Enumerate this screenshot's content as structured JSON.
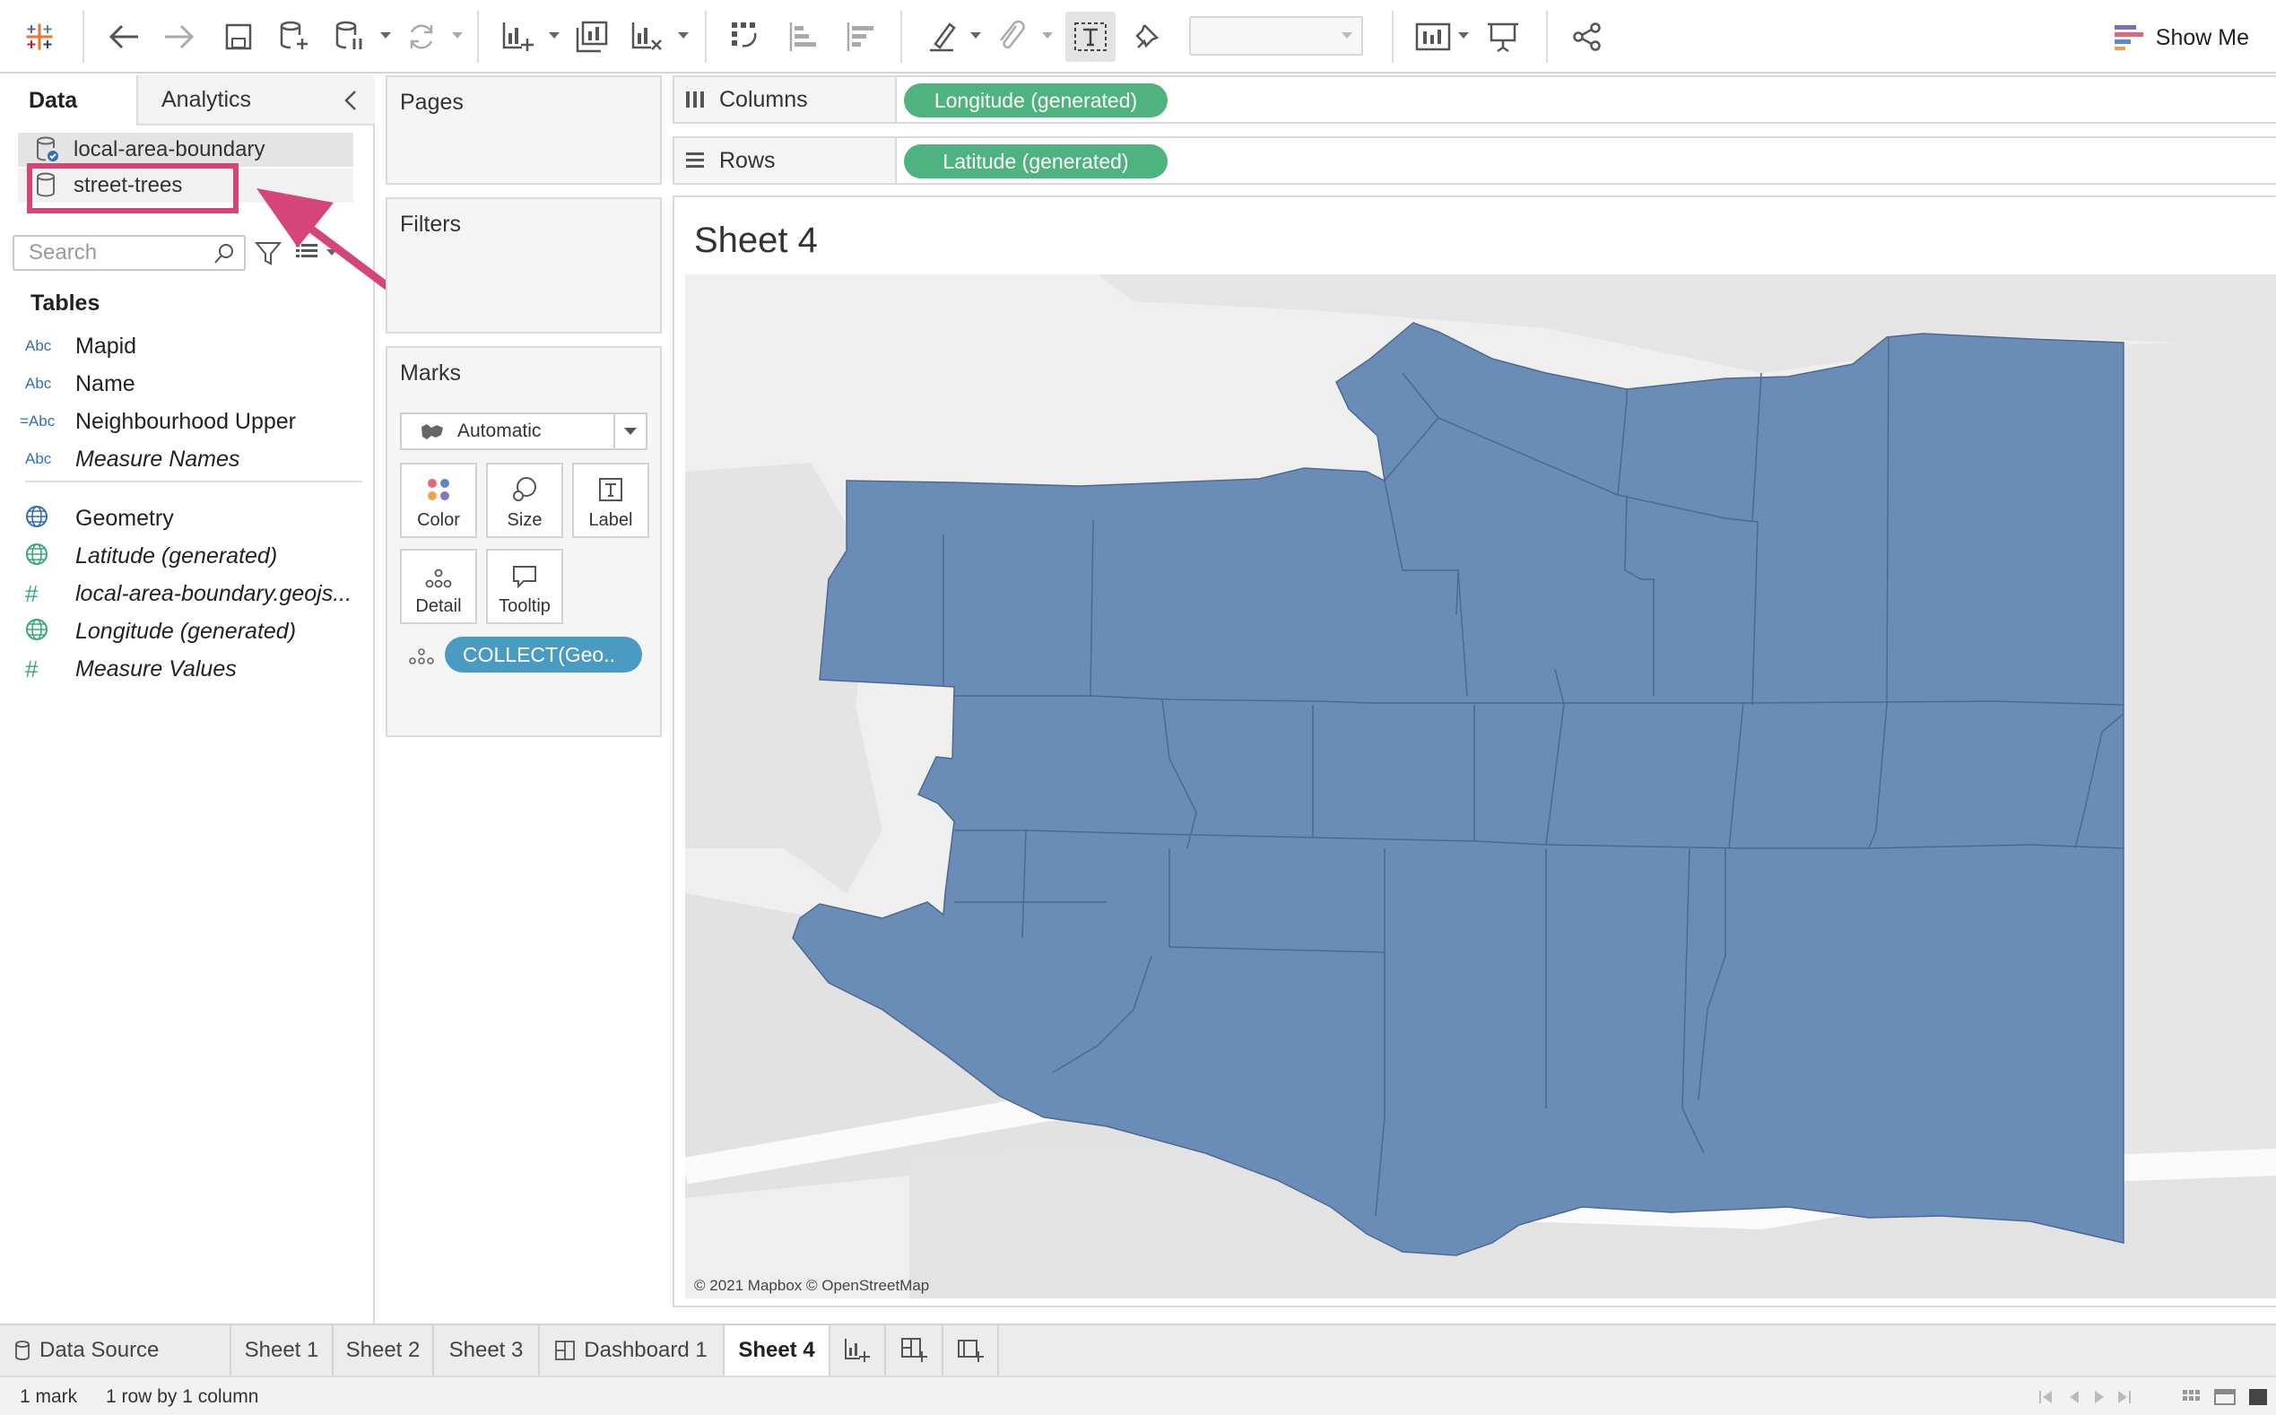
{
  "toolbar": {
    "show_me_label": "Show Me"
  },
  "left_pane": {
    "tabs": {
      "data": "Data",
      "analytics": "Analytics"
    },
    "data_sources": [
      "local-area-boundary",
      "street-trees"
    ],
    "search_placeholder": "Search",
    "tables_heading": "Tables",
    "fields": [
      {
        "type_icon": "Abc",
        "name": "Mapid"
      },
      {
        "type_icon": "Abc",
        "name": "Name"
      },
      {
        "type_icon": "=Abc",
        "name": "Neighbourhood Upper"
      },
      {
        "type_icon": "Abc",
        "name": "Measure Names"
      },
      {
        "type_icon": "globe",
        "name": "Geometry"
      },
      {
        "type_icon": "globe",
        "name": "Latitude (generated)"
      },
      {
        "type_icon": "#",
        "name": "local-area-boundary.geojs..."
      },
      {
        "type_icon": "globe",
        "name": "Longitude (generated)"
      },
      {
        "type_icon": "#",
        "name": "Measure Values"
      }
    ]
  },
  "cards": {
    "pages": "Pages",
    "filters": "Filters",
    "marks": {
      "title": "Marks",
      "mark_type": "Automatic",
      "buttons": {
        "color": "Color",
        "size": "Size",
        "label": "Label",
        "detail": "Detail",
        "tooltip": "Tooltip"
      },
      "pill": "COLLECT(Geo.."
    }
  },
  "shelves": {
    "columns": {
      "label": "Columns",
      "pill": "Longitude (generated)"
    },
    "rows": {
      "label": "Rows",
      "pill": "Latitude (generated)"
    }
  },
  "viz": {
    "sheet_title": "Sheet 4",
    "attribution": "© 2021 Mapbox © OpenStreetMap",
    "fill_color": "#6a8db7"
  },
  "tabs": {
    "data_source": "Data Source",
    "sheets": [
      "Sheet 1",
      "Sheet 2",
      "Sheet 3",
      "Dashboard 1",
      "Sheet 4"
    ],
    "active": "Sheet 4"
  },
  "status": {
    "marks": "1 mark",
    "rows_cols": "1 row by 1 column"
  },
  "colors": {
    "highlight": "#d6457a",
    "pill_green": "#4fb37f",
    "pill_blue": "#4a9bc1"
  }
}
